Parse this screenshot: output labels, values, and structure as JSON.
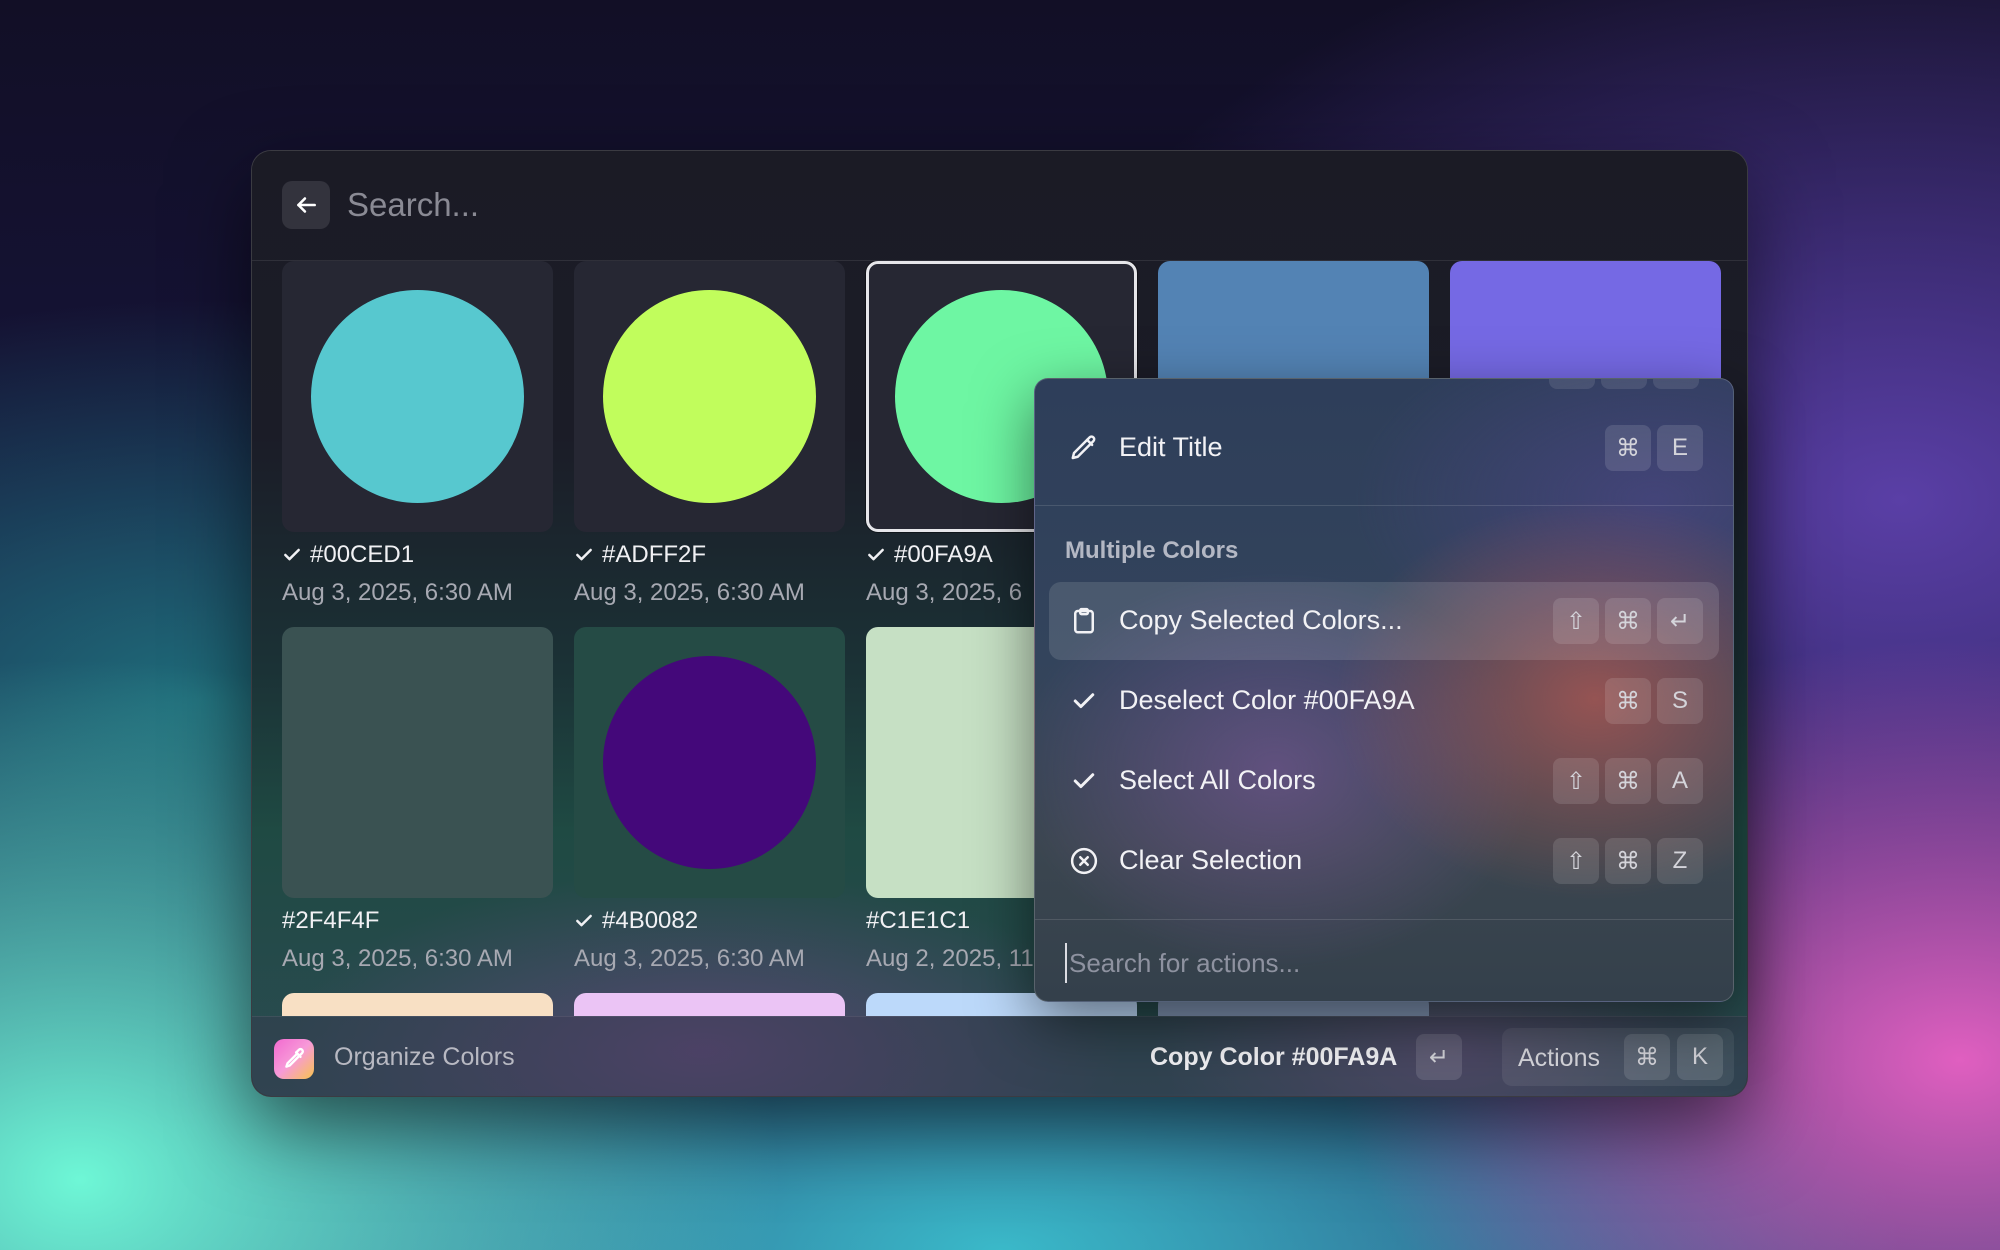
{
  "search": {
    "placeholder": "Search..."
  },
  "colors": [
    {
      "hex": "#00CED1",
      "date": "Aug 3, 2025, 6:30 AM",
      "selected": true,
      "swatch": "#57C8CF",
      "shape": "circle",
      "tile_bg": "#262733"
    },
    {
      "hex": "#ADFF2F",
      "date": "Aug 3, 2025, 6:30 AM",
      "selected": true,
      "swatch": "#C1FD5C",
      "shape": "circle",
      "tile_bg": "#262733"
    },
    {
      "hex": "#00FA9A",
      "date": "Aug 3, 2025, 6",
      "selected": true,
      "swatch": "#6EF6A3",
      "shape": "circle",
      "tile_bg": "#262733",
      "focused": true
    },
    {
      "hex": "",
      "date": "",
      "selected": false,
      "swatch": "#5383B4",
      "shape": "fill",
      "tile_bg": "#5383B4"
    },
    {
      "hex": "",
      "date": "",
      "selected": false,
      "swatch": "#7569E4",
      "shape": "fill",
      "tile_bg": "#7569E4"
    },
    {
      "hex": "#2F4F4F",
      "date": "Aug 3, 2025, 6:30 AM",
      "selected": false,
      "swatch": "#3A5252",
      "shape": "fill",
      "tile_bg": "#3A5252"
    },
    {
      "hex": "#4B0082",
      "date": "Aug 3, 2025, 6:30 AM",
      "selected": true,
      "swatch": "#44087A",
      "shape": "circle",
      "tile_bg": "#254B45"
    },
    {
      "hex": "#C1E1C1",
      "date": "Aug 2, 2025, 11",
      "selected": false,
      "swatch": "#C6E0C4",
      "shape": "fill",
      "tile_bg": "#C6E0C4"
    },
    {
      "hex": "",
      "date": "",
      "selected": false,
      "swatch": "#F8E0C4",
      "shape": "fill",
      "tile_bg": "#F8E0C4"
    },
    {
      "hex": "",
      "date": "",
      "selected": false,
      "swatch": "#EBC4F5",
      "shape": "fill",
      "tile_bg": "#EBC4F5"
    },
    {
      "hex": "",
      "date": "",
      "selected": false,
      "swatch": "#BCD9FA",
      "shape": "fill",
      "tile_bg": "#BCD9FA"
    },
    {
      "hex": "",
      "date": "",
      "selected": false,
      "swatch": "#7F93B2",
      "shape": "fill",
      "tile_bg": "#7F93B2"
    }
  ],
  "actions_panel": {
    "edit_title": {
      "label": "Edit Title",
      "keys": [
        "⌘",
        "E"
      ],
      "icon": "pencil-icon"
    },
    "section_title": "Multiple Colors",
    "items": [
      {
        "label": "Copy Selected Colors...",
        "keys": [
          "⇧",
          "⌘",
          "↵"
        ],
        "icon": "clipboard-icon",
        "active": true
      },
      {
        "label": "Deselect Color #00FA9A",
        "keys": [
          "⌘",
          "S"
        ],
        "icon": "check-icon",
        "active": false
      },
      {
        "label": "Select All Colors",
        "keys": [
          "⇧",
          "⌘",
          "A"
        ],
        "icon": "check-icon",
        "active": false
      },
      {
        "label": "Clear Selection",
        "keys": [
          "⇧",
          "⌘",
          "Z"
        ],
        "icon": "x-circle-icon",
        "active": false
      }
    ],
    "search_placeholder": "Search for actions..."
  },
  "footer": {
    "app_title": "Organize Colors",
    "primary_action": "Copy Color #00FA9A",
    "primary_key": "↵",
    "actions_label": "Actions",
    "actions_keys": [
      "⌘",
      "K"
    ]
  }
}
